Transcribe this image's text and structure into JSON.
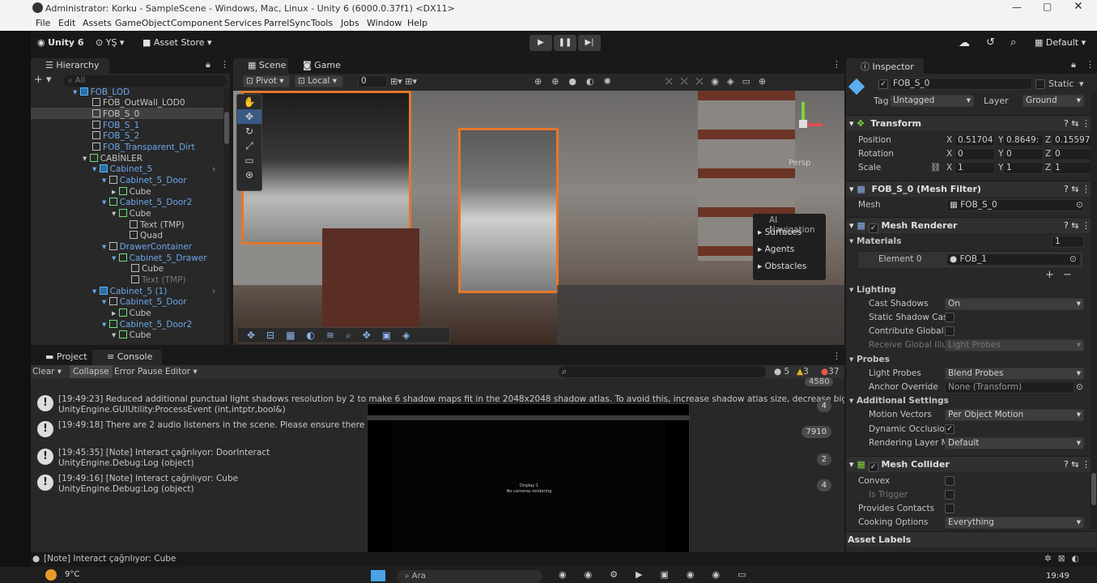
{
  "title_bar": {
    "title": "Administrator: Korku - SampleScene - Windows, Mac, Linux - Unity 6 (6000.0.37f1) <DX11>"
  },
  "menu": [
    "File",
    "Edit",
    "Assets",
    "GameObject",
    "Component",
    "Services",
    "ParrelSync",
    "Tools",
    "Jobs",
    "Window",
    "Help"
  ],
  "toolbar": {
    "unity": "Unity 6",
    "account": "YŞ",
    "asset_store": "Asset Store",
    "layout": "Default"
  },
  "hierarchy": {
    "tab": "Hierarchy",
    "search_placeholder": "All",
    "items": [
      {
        "label": "FOB_LOD",
        "color": "blue"
      },
      {
        "label": "FOB_OutWall_LOD0",
        "color": "white"
      },
      {
        "label": "FOB_S_0",
        "color": "white"
      },
      {
        "label": "FOB_S_1",
        "color": "blue"
      },
      {
        "label": "FOB_S_2",
        "color": "blue"
      },
      {
        "label": "FOB_Transparent_Dirt",
        "color": "blue"
      },
      {
        "label": "CABİNLER",
        "color": "white"
      },
      {
        "label": "Cabinet_5",
        "color": "blue"
      },
      {
        "label": "Cabinet_5_Door",
        "color": "blue"
      },
      {
        "label": "Cube",
        "color": "white"
      },
      {
        "label": "Cabinet_5_Door2",
        "color": "blue"
      },
      {
        "label": "Cube",
        "color": "white"
      },
      {
        "label": "Text (TMP)",
        "color": "white"
      },
      {
        "label": "Quad",
        "color": "white"
      },
      {
        "label": "DrawerContainer",
        "color": "blue"
      },
      {
        "label": "Cabinet_5_Drawer",
        "color": "blue"
      },
      {
        "label": "Cube",
        "color": "white"
      },
      {
        "label": "Text (TMP)",
        "color": "gray"
      },
      {
        "label": "Cabinet_5 (1)",
        "color": "blue"
      },
      {
        "label": "Cabinet_5_Door",
        "color": "blue"
      },
      {
        "label": "Cube",
        "color": "white"
      },
      {
        "label": "Cabinet_5_Door2",
        "color": "blue"
      },
      {
        "label": "Cube",
        "color": "white"
      }
    ]
  },
  "scene": {
    "tabs": [
      "Scene",
      "Game"
    ],
    "pivot": "Pivot",
    "local": "Local",
    "snap_value": "0",
    "persp": "Persp",
    "ai_navigation": {
      "title": "AI Navigation",
      "items": [
        "Surfaces",
        "Agents",
        "Obstacles"
      ]
    }
  },
  "console": {
    "tabs": [
      "Project",
      "Console"
    ],
    "toolbar": {
      "clear": "Clear",
      "collapse": "Collapse",
      "error_pause": "Error Pause",
      "editor": "Editor"
    },
    "counts": {
      "info": "5",
      "warn": "3",
      "error": "37"
    },
    "logs": [
      {
        "line1": "[19:49:23] Reduced additional punctual light shadows resolution by 2 to make 6 shadow maps fit in the 2048x2048 shadow atlas. To avoid this, increase shadow atlas size, decrease big shadow reso",
        "line2": "UnityEngine.GUIUtility:ProcessEvent (int,intptr,bool&)",
        "count": "4"
      },
      {
        "line1": "[19:49:18] There are 2 audio listeners in the scene. Please ensure there is alwa",
        "line2": "",
        "count": "7910"
      },
      {
        "line1": "[19:45:35] [Note] Interact çağrılıyor: DoorInteract",
        "line2": "UnityEngine.Debug:Log (object)",
        "count": "2"
      },
      {
        "line1": "[19:49:16] [Note] Interact çağrılıyor: Cube",
        "line2": "UnityEngine.Debug:Log (object)",
        "count": "4"
      }
    ],
    "top_badge": "4580"
  },
  "game_overlay": {
    "display": "Display 1",
    "message": "No cameras rendering"
  },
  "inspector": {
    "tab": "Inspector",
    "object_name": "FOB_S_0",
    "static_label": "Static",
    "tag_label": "Tag",
    "tag": "Untagged",
    "layer_label": "Layer",
    "layer": "Ground",
    "transform": {
      "title": "Transform",
      "position_label": "Position",
      "position": [
        "0.51704",
        "0.8649:",
        "0.15597"
      ],
      "rotation_label": "Rotation",
      "rotation": [
        "0",
        "0",
        "0"
      ],
      "scale_label": "Scale",
      "scale": [
        "1",
        "1",
        "1"
      ]
    },
    "mesh_filter": {
      "title": "FOB_S_0 (Mesh Filter)",
      "mesh_label": "Mesh",
      "mesh": "FOB_S_0"
    },
    "mesh_renderer": {
      "title": "Mesh Renderer",
      "materials_label": "Materials",
      "materials_count": "1",
      "element_label": "Element 0",
      "element": "FOB_1",
      "lighting": "Lighting",
      "cast_shadows_label": "Cast Shadows",
      "cast_shadows": "On",
      "static_shadow_label": "Static Shadow Cas",
      "contribute_gi_label": "Contribute Global I",
      "receive_gi_label": "Receive Global Illur",
      "receive_gi": "Light Probes",
      "probes": "Probes",
      "light_probes_label": "Light Probes",
      "light_probes": "Blend Probes",
      "anchor_label": "Anchor Override",
      "anchor": "None (Transform)",
      "additional": "Additional Settings",
      "motion_vectors_label": "Motion Vectors",
      "motion_vectors": "Per Object Motion",
      "dynamic_occlusion_label": "Dynamic Occlusion",
      "rendering_layer_label": "Rendering Layer M",
      "rendering_layer": "Default"
    },
    "mesh_collider": {
      "title": "Mesh Collider",
      "convex": "Convex",
      "is_trigger": "Is Trigger",
      "provides_contacts": "Provides Contacts",
      "cooking_label": "Cooking Options",
      "cooking": "Everything"
    },
    "asset_labels": "Asset Labels"
  },
  "status_bar": {
    "message": "[Note] Interact çağrılıyor: Cube"
  },
  "taskbar": {
    "temp": "9°C",
    "time": "19:49",
    "search": "Ara"
  }
}
